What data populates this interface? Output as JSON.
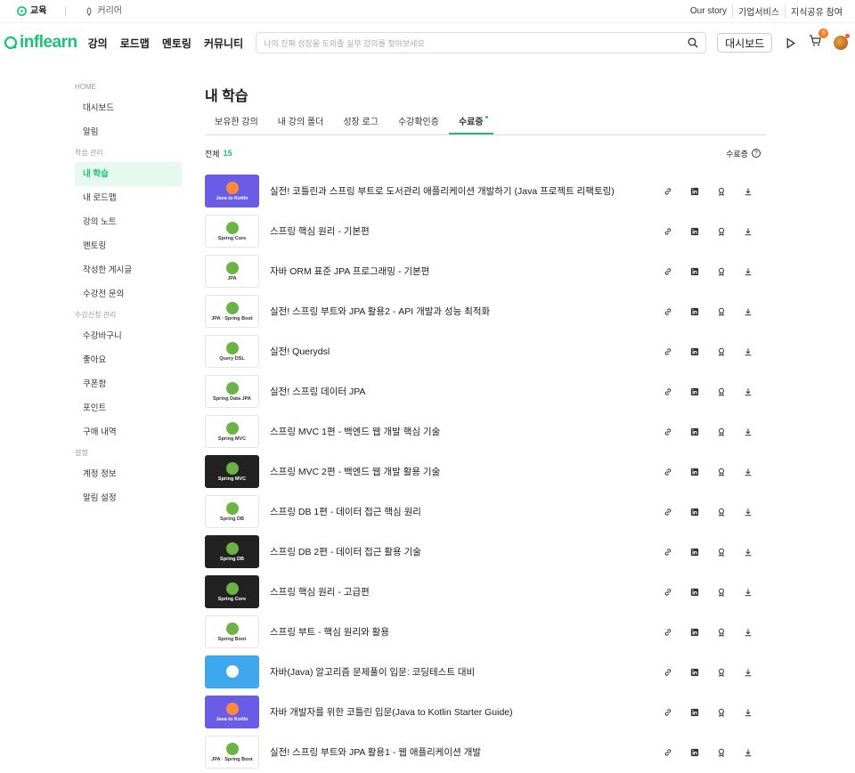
{
  "util": {
    "tab_active": "교육",
    "tab_inactive": "커리어",
    "links": [
      "Our story",
      "기업서비스",
      "지식공유 참여"
    ]
  },
  "header": {
    "logo": "inflearn",
    "nav": [
      "강의",
      "로드맵",
      "멘토링",
      "커뮤니티"
    ],
    "search_placeholder": "나의 진짜 성장을 도와줄 실무 강의를 찾아보세요",
    "dashboard_label": "대시보드",
    "cart_count": "6"
  },
  "sidebar": {
    "home": "HOME",
    "home_items": [
      "대시보드",
      "알림"
    ],
    "group_learning": "학습 관리",
    "learning_items": [
      "내 학습",
      "내 로드맵",
      "강의 노트",
      "멘토링",
      "작성한 게시글",
      "수강전 문의"
    ],
    "group_apply": "수강신청 관리",
    "apply_items": [
      "수강바구니",
      "좋아요",
      "쿠폰함",
      "포인트",
      "구매 내역"
    ],
    "group_settings": "설정",
    "settings_items": [
      "계정 정보",
      "알림 설정"
    ]
  },
  "main": {
    "title": "내 학습",
    "tabs": [
      "보유한 강의",
      "내 강의 폴더",
      "성장 로그",
      "수강확인증",
      "수료증"
    ],
    "total_label": "전체",
    "total_count": "15",
    "cert_label": "수료증",
    "courses": [
      {
        "title": "실전! 코틀린과 스프링 부트로 도서관리 애플리케이션 개발하기 (Java 프로젝트 리팩토링)",
        "thumb": "Java to Kotlin",
        "style": "kotlin"
      },
      {
        "title": "스프링 핵심 원리 - 기본편",
        "thumb": "Spring Core",
        "style": "light"
      },
      {
        "title": "자바 ORM 표준 JPA 프로그래밍 - 기본편",
        "thumb": "JPA",
        "style": "light"
      },
      {
        "title": "실전! 스프링 부트와 JPA 활용2 - API 개발과 성능 최적화",
        "thumb": "JPA · Spring Boot",
        "style": "light"
      },
      {
        "title": "실전! Querydsl",
        "thumb": "Query DSL",
        "style": "light"
      },
      {
        "title": "실전! 스프링 데이터 JPA",
        "thumb": "Spring Data JPA",
        "style": "light"
      },
      {
        "title": "스프링 MVC 1편 - 백엔드 웹 개발 핵심 기술",
        "thumb": "Spring MVC",
        "style": "light"
      },
      {
        "title": "스프링 MVC 2편 - 백엔드 웹 개발 활용 기술",
        "thumb": "Spring MVC",
        "style": "dark"
      },
      {
        "title": "스프링 DB 1편 - 데이터 접근 핵심 원리",
        "thumb": "Spring DB",
        "style": "light"
      },
      {
        "title": "스프링 DB 2편 - 데이터 접근 활용 기술",
        "thumb": "Spring DB",
        "style": "dark"
      },
      {
        "title": "스프링 핵심 원리 - 고급편",
        "thumb": "Spring Core",
        "style": "dark"
      },
      {
        "title": "스프링 부트 - 핵심 원리와 활용",
        "thumb": "Spring Boot",
        "style": "light"
      },
      {
        "title": "자바(Java) 알고리즘 문제풀이 입문: 코딩테스트 대비",
        "thumb": "",
        "style": "algo"
      },
      {
        "title": "자바 개발자를 위한 코틀린 입문(Java to Kotlin Starter Guide)",
        "thumb": "Java to Kotlin",
        "style": "kotlin"
      },
      {
        "title": "실전! 스프링 부트와 JPA 활용1 - 웹 애플리케이션 개발",
        "thumb": "JPA · Spring Boot",
        "style": "light"
      }
    ]
  },
  "colors": {
    "accent": "#1dc078",
    "badge": "#ff7c24"
  }
}
